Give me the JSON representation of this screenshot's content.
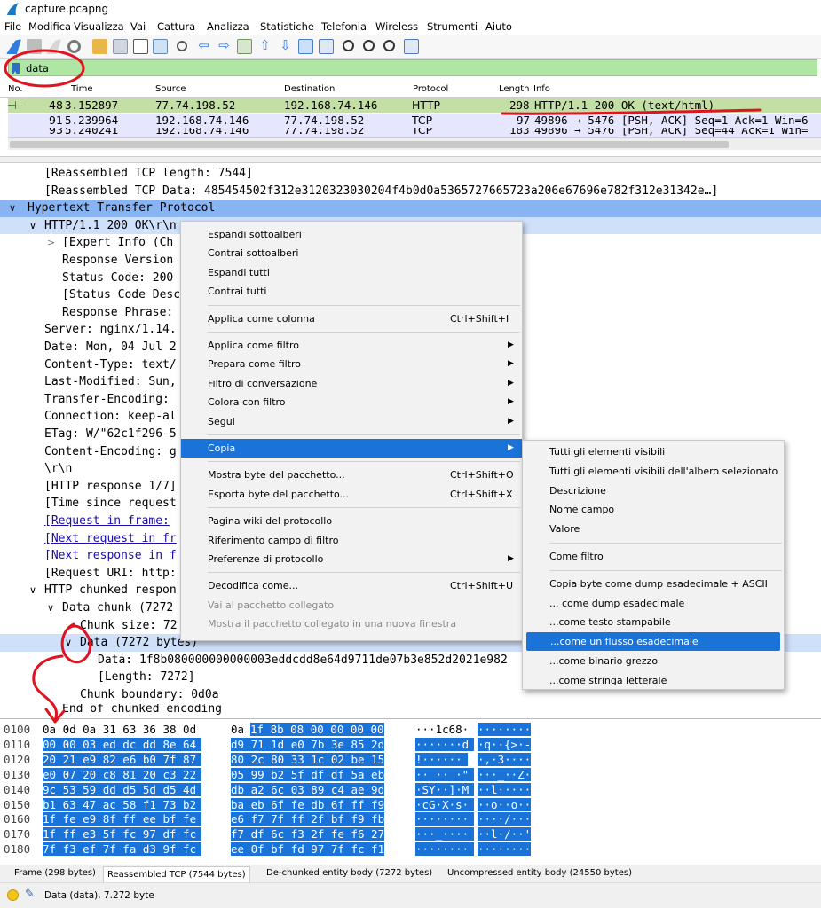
{
  "window": {
    "title": "capture.pcapng"
  },
  "menubar": [
    "File",
    "Modifica",
    "Visualizza",
    "Vai",
    "Cattura",
    "Analizza",
    "Statistiche",
    "Telefonia",
    "Wireless",
    "Strumenti",
    "Aiuto"
  ],
  "filter": {
    "value": "data"
  },
  "packet_list": {
    "columns": [
      "No.",
      "Time",
      "Source",
      "Destination",
      "Protocol",
      "Length",
      "Info"
    ],
    "rows": [
      {
        "no": "48",
        "time": "3.152897",
        "source": "77.74.198.52",
        "destination": "192.168.74.146",
        "protocol": "HTTP",
        "length": "298",
        "info": "HTTP/1.1 200 OK  (text/html)"
      },
      {
        "no": "91",
        "time": "5.239964",
        "source": "192.168.74.146",
        "destination": "77.74.198.52",
        "protocol": "TCP",
        "length": "97",
        "info": "49896 → 5476 [PSH, ACK] Seq=1 Ack=1 Win=6"
      },
      {
        "no": "93",
        "time": "5.240241",
        "source": "192.168.74.146",
        "destination": "77.74.198.52",
        "protocol": "TCP",
        "length": "183",
        "info": "49896 → 5476 [PSH, ACK] Seq=44 Ack=1 Win="
      }
    ]
  },
  "tree": [
    {
      "text": "[Reassembled TCP length: 7544]"
    },
    {
      "text": "[Reassembled TCP Data: 485454502f312e3120323030204f4b0d0a5365727665723a206e67696e782f312e31342e…]"
    },
    {
      "arrow": "∨",
      "text": "Hypertext Transfer Protocol"
    },
    {
      "arrow": "∨",
      "text": "HTTP/1.1 200 OK\\r\\n"
    },
    {
      "arrow": ">",
      "text": "[Expert Info (Ch"
    },
    {
      "text": "Response Version"
    },
    {
      "text": "Status Code: 200"
    },
    {
      "text": "[Status Code Desc"
    },
    {
      "text": "Response Phrase:"
    },
    {
      "text": "Server: nginx/1.14."
    },
    {
      "text": "Date: Mon, 04 Jul 2"
    },
    {
      "text": "Content-Type: text/"
    },
    {
      "text": "Last-Modified: Sun,"
    },
    {
      "text": "Transfer-Encoding:"
    },
    {
      "text": "Connection: keep-al"
    },
    {
      "text": "ETag: W/\"62c1f296-5"
    },
    {
      "text": "Content-Encoding: g"
    },
    {
      "text": "\\r\\n"
    },
    {
      "text": "[HTTP response 1/7]"
    },
    {
      "text": "[Time since request"
    },
    {
      "text": "[Request in frame:",
      "link": true
    },
    {
      "text": "[Next request in fr",
      "link": true
    },
    {
      "text": "[Next response in f",
      "link": true
    },
    {
      "text": "[Request URI: http:"
    },
    {
      "arrow": "∨",
      "text": "HTTP chunked respon"
    },
    {
      "arrow": "∨",
      "text": "Data chunk (7272"
    },
    {
      "text": "Chunk size: 72"
    },
    {
      "arrow": "∨",
      "text": "Data (7272 bytes)"
    },
    {
      "text": "Data: 1f8b080000000000003eddcdd8e64d9711de07b3e852d2021e982"
    },
    {
      "text": "[Length: 7272]"
    },
    {
      "text": "Chunk boundary: 0d0a"
    },
    {
      "text": "End of chunked encoding"
    }
  ],
  "context_menu": [
    {
      "label": "Espandi sottoalberi"
    },
    {
      "label": "Contrai sottoalberi"
    },
    {
      "label": "Espandi tutti"
    },
    {
      "label": "Contrai tutti"
    },
    {
      "sep": true
    },
    {
      "label": "Applica come colonna",
      "shortcut": "Ctrl+Shift+I"
    },
    {
      "sep": true
    },
    {
      "label": "Applica come filtro",
      "submenu": true
    },
    {
      "label": "Prepara come filtro",
      "submenu": true
    },
    {
      "label": "Filtro di conversazione",
      "submenu": true
    },
    {
      "label": "Colora con filtro",
      "submenu": true
    },
    {
      "label": "Segui",
      "submenu": true
    },
    {
      "sep": true
    },
    {
      "label": "Copia",
      "submenu": true,
      "highlighted": true
    },
    {
      "sep": true
    },
    {
      "label": "Mostra byte del pacchetto...",
      "shortcut": "Ctrl+Shift+O"
    },
    {
      "label": "Esporta byte del pacchetto...",
      "shortcut": "Ctrl+Shift+X"
    },
    {
      "sep": true
    },
    {
      "label": "Pagina wiki del protocollo"
    },
    {
      "label": "Riferimento campo di filtro"
    },
    {
      "label": "Preferenze di protocollo",
      "submenu": true
    },
    {
      "sep": true
    },
    {
      "label": "Decodifica come...",
      "shortcut": "Ctrl+Shift+U"
    },
    {
      "label": "Vai al pacchetto collegato",
      "disabled": true
    },
    {
      "label": "Mostra il pacchetto collegato in una nuova finestra",
      "disabled": true
    }
  ],
  "copy_submenu": [
    {
      "label": "Tutti gli elementi visibili"
    },
    {
      "label": "Tutti gli elementi visibili dell'albero selezionato"
    },
    {
      "label": "Descrizione"
    },
    {
      "label": "Nome campo"
    },
    {
      "label": "Valore"
    },
    {
      "sep": true
    },
    {
      "label": "Come filtro"
    },
    {
      "sep": true
    },
    {
      "label": "Copia byte come dump esadecimale + ASCII"
    },
    {
      "label": "... come dump esadecimale"
    },
    {
      "label": "...come testo stampabile"
    },
    {
      "label": "...come un flusso esadecimale",
      "highlighted": true
    },
    {
      "label": "...come binario grezzo"
    },
    {
      "label": "...come stringa letterale"
    }
  ],
  "bytes": [
    {
      "off": "0100",
      "h1": "0a 0d 0a 31 63 36 38 0d",
      "h2": "0a 1f 8b 08 00 00 00 00",
      "a1": "···1c68·",
      "a2": "········",
      "hl_start": 9
    },
    {
      "off": "0110",
      "h1": "00 00 03 ed dc dd 8e 64",
      "h2": "d9 71 1d e0 7b 3e 85 2d",
      "a1": "·······d",
      "a2": "·q··{>·-",
      "hl_start": 0
    },
    {
      "off": "0120",
      "h1": "20 21 e9 82 e6 b0 7f 87",
      "h2": "80 2c 80 33 1c 02 be 15",
      "a1": " !······",
      "a2": "·,·3····",
      "hl_start": 0
    },
    {
      "off": "0130",
      "h1": "e0 07 20 c8 81 20 c3 22",
      "h2": "05 99 b2 5f df df 5a eb",
      "a1": "·· ·· ·\"",
      "a2": "···_··Z·",
      "hl_start": 0
    },
    {
      "off": "0140",
      "h1": "9c 53 59 dd d5 5d d5 4d",
      "h2": "db a2 6c 03 89 c4 ae 9d",
      "a1": "·SY··]·M",
      "a2": "··l·····",
      "hl_start": 0
    },
    {
      "off": "0150",
      "h1": "b1 63 47 ac 58 f1 73 b2",
      "h2": "ba eb 6f fe db 6f ff f9",
      "a1": "·cG·X·s·",
      "a2": "··o··o··",
      "hl_start": 0
    },
    {
      "off": "0160",
      "h1": "1f fe e9 8f ff ee bf fe",
      "h2": "e6 f7 7f ff 2f bf f9 fb",
      "a1": "········",
      "a2": "····/···",
      "hl_start": 0
    },
    {
      "off": "0170",
      "h1": "1f ff e3 5f fc 97 df fc",
      "h2": "f7 df 6c f3 2f fe f6 27",
      "a1": "···_····",
      "a2": "··l·/··'",
      "hl_start": 0
    },
    {
      "off": "0180",
      "h1": "7f f3 ef 7f fa d3 9f fc",
      "h2": "ee 0f bf fd 97 7f fc f1",
      "a1": "········",
      "a2": "········",
      "hl_start": 0
    }
  ],
  "bytes_tabs": [
    "Frame (298 bytes)",
    "Reassembled TCP (7544 bytes)",
    "De-chunked entity body (7272 bytes)",
    "Uncompressed entity body (24550 bytes)"
  ],
  "status": {
    "text": "Data (data), 7.272 byte"
  },
  "colors": {
    "selection": "#89b4f3",
    "menu_highlight": "#1a73d9",
    "filter_ok": "#afe6a3",
    "annotation": "#e0141e"
  }
}
